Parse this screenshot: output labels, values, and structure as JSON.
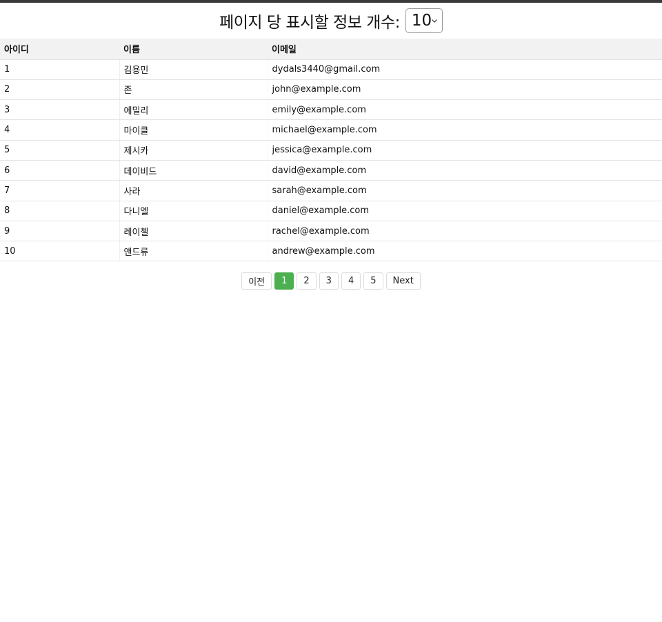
{
  "header": {
    "label": "페이지 당 표시할 정보 개수:",
    "per_page_value": "10"
  },
  "table": {
    "columns": [
      "아이디",
      "이름",
      "이메일"
    ],
    "rows": [
      {
        "id": "1",
        "name": "김용민",
        "email": "dydals3440@gmail.com"
      },
      {
        "id": "2",
        "name": "존",
        "email": "john@example.com"
      },
      {
        "id": "3",
        "name": "에밀리",
        "email": "emily@example.com"
      },
      {
        "id": "4",
        "name": "마이클",
        "email": "michael@example.com"
      },
      {
        "id": "5",
        "name": "제시카",
        "email": "jessica@example.com"
      },
      {
        "id": "6",
        "name": "데이비드",
        "email": "david@example.com"
      },
      {
        "id": "7",
        "name": "사라",
        "email": "sarah@example.com"
      },
      {
        "id": "8",
        "name": "다니엘",
        "email": "daniel@example.com"
      },
      {
        "id": "9",
        "name": "레이첼",
        "email": "rachel@example.com"
      },
      {
        "id": "10",
        "name": "앤드류",
        "email": "andrew@example.com"
      }
    ]
  },
  "pagination": {
    "prev_label": "이전",
    "pages": [
      "1",
      "2",
      "3",
      "4",
      "5"
    ],
    "active_page": "1",
    "next_label": "Next"
  },
  "colors": {
    "active_page": "#4caf50",
    "header_row": "#f2f2f2",
    "top_bar": "#3a3a3a"
  }
}
